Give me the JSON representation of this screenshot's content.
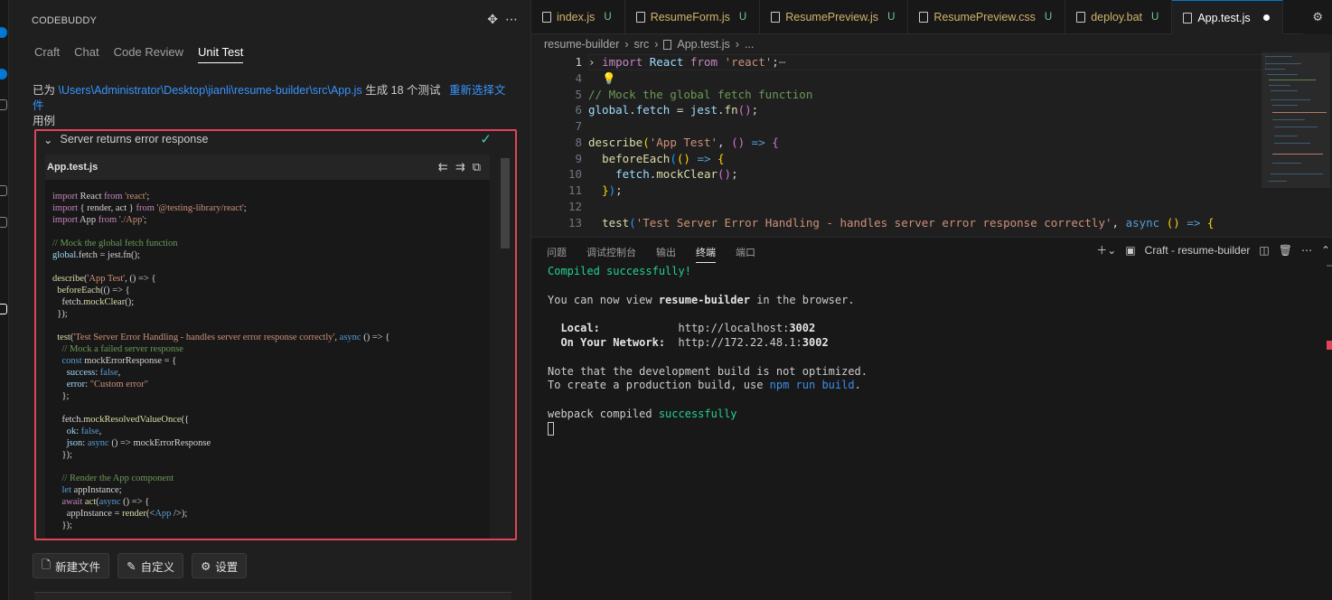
{
  "left_panel": {
    "header": "CODEBUDDY",
    "tabs": [
      {
        "label": "Craft"
      },
      {
        "label": "Chat"
      },
      {
        "label": "Code Review"
      },
      {
        "label": "Unit Test"
      }
    ],
    "info_prefix": "已为 ",
    "info_path": "\\Users\\Administrator\\Desktop\\jianli\\resume-builder\\src\\App.js",
    "info_suffix": " 生成 18 个测试",
    "info_link": "重新选择文件",
    "info_tail": "用例",
    "test_case": {
      "title": "Server returns error response",
      "file_name": "App.test.js"
    },
    "buttons": [
      {
        "label": "新建文件"
      },
      {
        "label": "自定义"
      },
      {
        "label": "设置"
      }
    ]
  },
  "editor": {
    "tabs": [
      {
        "label": "index.js",
        "status": "U"
      },
      {
        "label": "ResumeForm.js",
        "status": "U"
      },
      {
        "label": "ResumePreview.js",
        "status": "U"
      },
      {
        "label": "ResumePreview.css",
        "status": "U"
      },
      {
        "label": "deploy.bat",
        "status": "U"
      },
      {
        "label": "App.test.js",
        "status": ""
      }
    ],
    "breadcrumb": [
      "resume-builder",
      "src",
      "App.test.js",
      "..."
    ],
    "line_numbers": [
      "1",
      "4",
      "5",
      "6",
      "7",
      "8",
      "9",
      "10",
      "11",
      "12",
      "13"
    ]
  },
  "panel": {
    "tabs": [
      {
        "label": "问题"
      },
      {
        "label": "调试控制台"
      },
      {
        "label": "输出"
      },
      {
        "label": "终端"
      },
      {
        "label": "端口"
      }
    ],
    "terminal_name": "Craft - resume-builder",
    "terminal": {
      "l1": "Compiled successfully!",
      "l2a": "You can now view ",
      "l2b": "resume-builder",
      "l2c": " in the browser.",
      "l3a": "  Local:",
      "l3b": "            http://localhost:",
      "l3c": "3002",
      "l4a": "  On Your Network:",
      "l4b": "  http://172.22.48.1:",
      "l4c": "3002",
      "l5": "Note that the development build is not optimized.",
      "l6a": "To create a production build, use ",
      "l6b": "npm run build",
      "l6c": ".",
      "l7a": "webpack compiled ",
      "l7b": "successfully"
    }
  },
  "icons": {
    "activity": [
      "codebuddy-icon",
      "extensions-icon"
    ],
    "colors": {
      "accent": "#0078d4",
      "highlight_border": "#e0445a",
      "success": "#23d18b",
      "untracked": "#73c991"
    }
  }
}
